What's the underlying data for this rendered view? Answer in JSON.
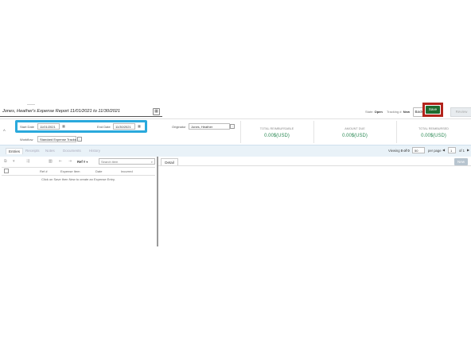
{
  "report": {
    "title": "Jones, Heather's Expense Report 11/01/2021 to 11/30/2021",
    "status_label": "State:",
    "status_value": "Open",
    "tracking_label": "Tracking #:",
    "tracking_value": "New"
  },
  "actions": {
    "back_label": "Back",
    "save_label": "Save",
    "review_label": "Review"
  },
  "form": {
    "start_date_label": "Start Date",
    "start_date_value": "11/01/2021",
    "end_date_label": "End Date",
    "end_date_value": "11/30/2021",
    "workflow_label": "Workflow",
    "workflow_value": "Standard Expense Tracks",
    "originator_label": "Originator",
    "originator_value": "Jones, Heather"
  },
  "totals": [
    {
      "label": "TOTAL REIMBURSABLE",
      "value": "0.00$(USD)"
    },
    {
      "label": "AMOUNT DUE",
      "value": "0.00$(USD)"
    },
    {
      "label": "TOTAL REIMBURSED",
      "value": "0.00$(USD)"
    }
  ],
  "tabs": [
    "Entries",
    "Receipts",
    "Notes",
    "Documents",
    "History"
  ],
  "pager": {
    "viewing_label": "Viewing",
    "viewing_value": "0 of 0",
    "page_size": "50",
    "per_page_label": "per page",
    "page_number": "1",
    "of_label": "of 1"
  },
  "toolbar": {
    "ref_filter": "Ref #",
    "search_placeholder": "Search item"
  },
  "table": {
    "columns": [
      "Ref #",
      "Expense Item",
      "Date",
      "Incurred"
    ],
    "empty_message": "Click on Save then New to create an Expense Entry."
  },
  "detail": {
    "tab_label": "Detail",
    "new_label": "New"
  },
  "colors": {
    "save": "#1e6b2f",
    "save_highlight": "#b3241c",
    "date_highlight": "#2aa9dc",
    "totals": "#2e8b57",
    "tabs_band": "#e9f2f8"
  }
}
